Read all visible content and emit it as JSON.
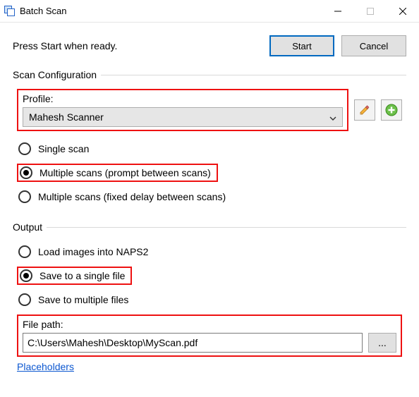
{
  "window": {
    "title": "Batch Scan"
  },
  "toprow": {
    "message": "Press Start when ready.",
    "start": "Start",
    "cancel": "Cancel"
  },
  "scan_config": {
    "legend": "Scan Configuration",
    "profile_label": "Profile:",
    "profile_value": "Mahesh Scanner",
    "opt_single": "Single scan",
    "opt_multi_prompt": "Multiple scans (prompt between scans)",
    "opt_multi_delay": "Multiple scans (fixed delay between scans)",
    "selected": "multi_prompt"
  },
  "output": {
    "legend": "Output",
    "opt_load": "Load images into NAPS2",
    "opt_single_file": "Save to a single file",
    "opt_multi_file": "Save to multiple files",
    "selected": "single_file",
    "filepath_label": "File path:",
    "filepath_value": "C:\\Users\\Mahesh\\Desktop\\MyScan.pdf",
    "browse": "...",
    "placeholders": "Placeholders"
  }
}
